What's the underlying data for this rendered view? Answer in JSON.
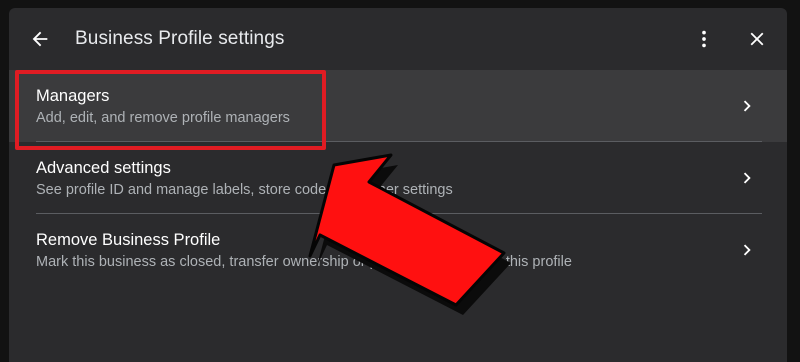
{
  "header": {
    "title": "Business Profile settings",
    "back_icon": "arrow-back-icon",
    "more_icon": "more-vert-icon",
    "close_icon": "close-icon"
  },
  "items": [
    {
      "title": "Managers",
      "subtitle": "Add, edit, and remove profile managers",
      "icon": "chevron-right-icon"
    },
    {
      "title": "Advanced settings",
      "subtitle": "See profile ID and manage labels, store codes and other settings",
      "icon": "chevron-right-icon"
    },
    {
      "title": "Remove Business Profile",
      "subtitle": "Mark this business as closed, transfer ownership or permanently remove this profile",
      "icon": "chevron-right-icon"
    }
  ],
  "colors": {
    "panel_background": "#2b2b2d",
    "highlight": "#e01c23",
    "text_primary": "#ffffff",
    "text_secondary": "#aeb2b6"
  },
  "annotation": {
    "highlighted_item": "Managers",
    "pointer_icon": "red-arrow-icon"
  }
}
